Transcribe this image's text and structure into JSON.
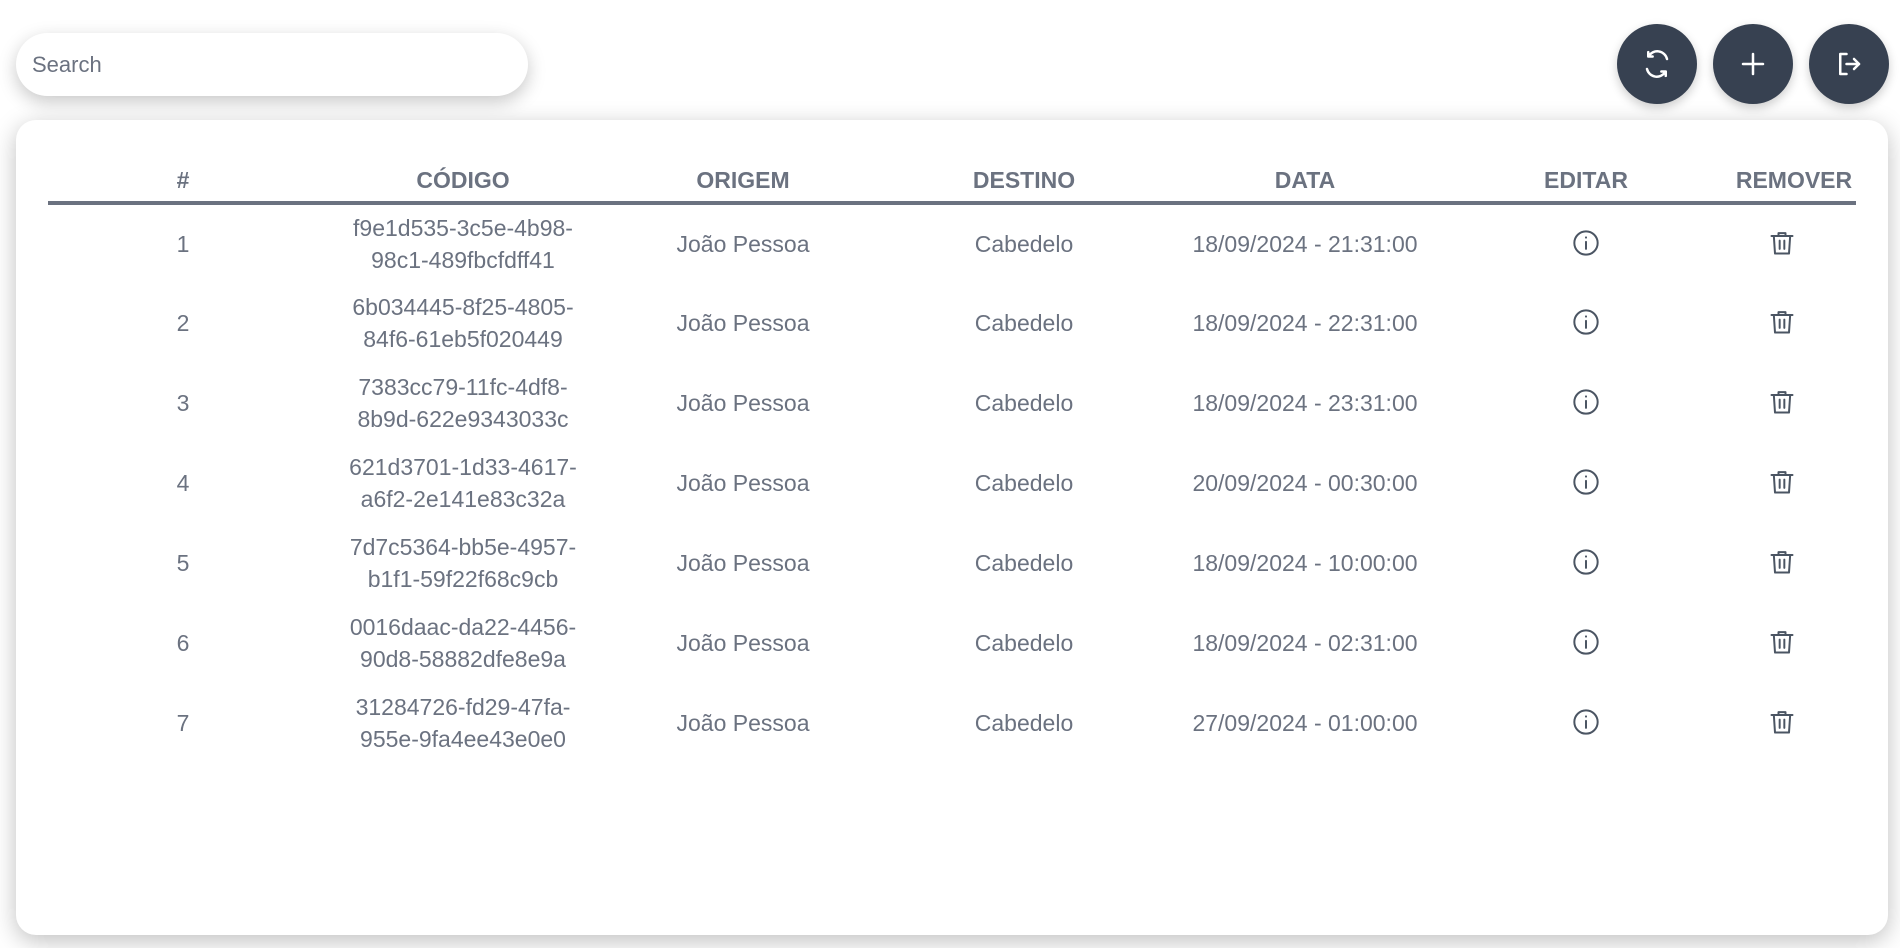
{
  "search": {
    "placeholder": "Search",
    "value": ""
  },
  "toolbar": {
    "refresh_icon": "refresh-icon",
    "add_icon": "plus-icon",
    "logout_icon": "logout-icon",
    "button_color": "#374151"
  },
  "table": {
    "headers": {
      "num": "#",
      "code": "CÓDIGO",
      "origin": "ORIGEM",
      "destination": "DESTINO",
      "date": "DATA",
      "edit": "EDITAR",
      "remove": "REMOVER"
    },
    "rows": [
      {
        "num": "1",
        "code": "f9e1d535-3c5e-4b98-98c1-489fbcfdff41",
        "origin": "João Pessoa",
        "destination": "Cabedelo",
        "date": "18/09/2024 - 21:31:00"
      },
      {
        "num": "2",
        "code": "6b034445-8f25-4805-84f6-61eb5f020449",
        "origin": "João Pessoa",
        "destination": "Cabedelo",
        "date": "18/09/2024 - 22:31:00"
      },
      {
        "num": "3",
        "code": "7383cc79-11fc-4df8-8b9d-622e9343033c",
        "origin": "João Pessoa",
        "destination": "Cabedelo",
        "date": "18/09/2024 - 23:31:00"
      },
      {
        "num": "4",
        "code": "621d3701-1d33-4617-a6f2-2e141e83c32a",
        "origin": "João Pessoa",
        "destination": "Cabedelo",
        "date": "20/09/2024 - 00:30:00"
      },
      {
        "num": "5",
        "code": "7d7c5364-bb5e-4957-b1f1-59f22f68c9cb",
        "origin": "João Pessoa",
        "destination": "Cabedelo",
        "date": "18/09/2024 - 10:00:00"
      },
      {
        "num": "6",
        "code": "0016daac-da22-4456-90d8-58882dfe8e9a",
        "origin": "João Pessoa",
        "destination": "Cabedelo",
        "date": "18/09/2024 - 02:31:00"
      },
      {
        "num": "7",
        "code": "31284726-fd29-47fa-955e-9fa4ee43e0e0",
        "origin": "João Pessoa",
        "destination": "Cabedelo",
        "date": "27/09/2024 - 01:00:00"
      }
    ],
    "edit_icon": "info-icon",
    "remove_icon": "trash-icon"
  }
}
